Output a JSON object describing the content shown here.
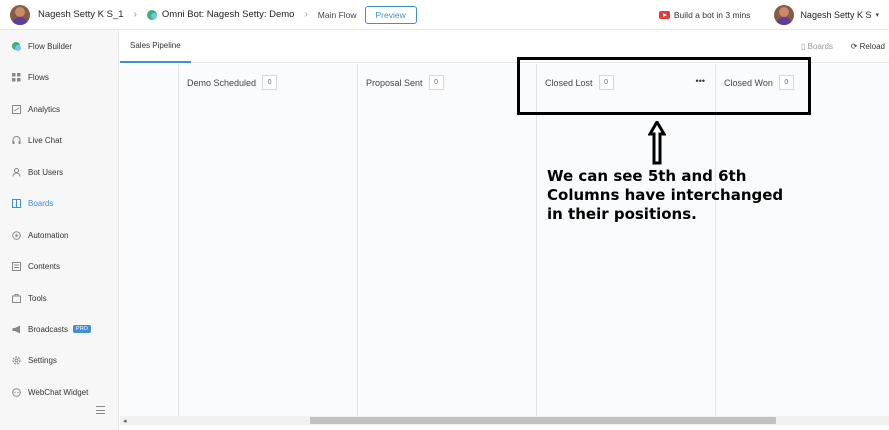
{
  "topbar": {
    "workspace_name": "Nagesh Setty K S_1",
    "bot_name": "Omni Bot: Nagesh Setty: Demo",
    "flow_name": "Main Flow",
    "preview_label": "Preview",
    "build_link": "Build a bot in 3 mins",
    "user_name": "Nagesh Setty K S"
  },
  "sidebar": {
    "items": [
      {
        "label": "Flow Builder",
        "icon": "flow-builder-icon"
      },
      {
        "label": "Flows",
        "icon": "flows-icon"
      },
      {
        "label": "Analytics",
        "icon": "analytics-icon"
      },
      {
        "label": "Live Chat",
        "icon": "headset-icon"
      },
      {
        "label": "Bot Users",
        "icon": "user-icon"
      },
      {
        "label": "Boards",
        "icon": "boards-icon"
      },
      {
        "label": "Automation",
        "icon": "automation-icon"
      },
      {
        "label": "Contents",
        "icon": "contents-icon"
      },
      {
        "label": "Tools",
        "icon": "tools-icon"
      },
      {
        "label": "Broadcasts",
        "icon": "megaphone-icon"
      },
      {
        "label": "Settings",
        "icon": "gear-icon"
      },
      {
        "label": "WebChat Widget",
        "icon": "webchat-icon"
      }
    ],
    "active_item": "Boards",
    "pro_badge": "PRO"
  },
  "main": {
    "tab_label": "Sales Pipeline",
    "boards_label": "Boards",
    "reload_label": "Reload",
    "columns": [
      {
        "title": "Demo Scheduled",
        "count": "0"
      },
      {
        "title": "Proposal Sent",
        "count": "0"
      },
      {
        "title": "Closed Lost",
        "count": "0"
      },
      {
        "title": "Closed Won",
        "count": "0"
      }
    ]
  },
  "annotation": {
    "text_line1": "We can see 5th and 6th",
    "text_line2": "Columns have interchanged",
    "text_line3": "in their positions."
  },
  "colors": {
    "accent": "#3f8fd6",
    "annotation": "#000000"
  }
}
